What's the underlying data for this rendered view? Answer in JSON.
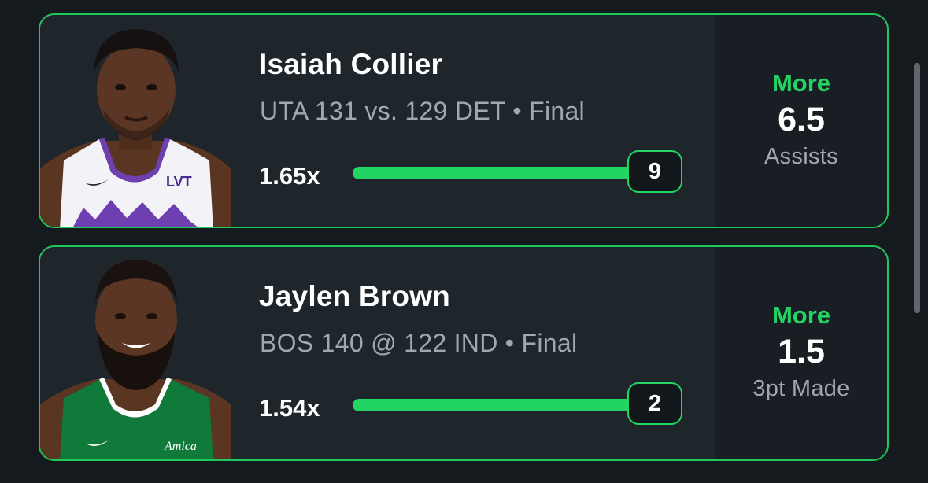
{
  "cards": [
    {
      "player": "Isaiah Collier",
      "game": "UTA 131 vs. 129 DET • Final",
      "multiplier": "1.65x",
      "result": "9",
      "progress": 1.0,
      "pick": "More",
      "line": "6.5",
      "stat": "Assists",
      "jersey_color": "#f2f2f7",
      "trim_color": "#6d3fb0"
    },
    {
      "player": "Jaylen Brown",
      "game": "BOS 140 @ 122 IND • Final",
      "multiplier": "1.54x",
      "result": "2",
      "progress": 1.0,
      "pick": "More",
      "line": "1.5",
      "stat": "3pt Made",
      "jersey_color": "#0f7a3a",
      "trim_color": "#ffffff"
    }
  ],
  "colors": {
    "accent": "#22d462",
    "background": "#151a1f",
    "card": "#1e252b"
  },
  "jersey_text": {
    "collier": "LVT",
    "brown": "Amica"
  }
}
